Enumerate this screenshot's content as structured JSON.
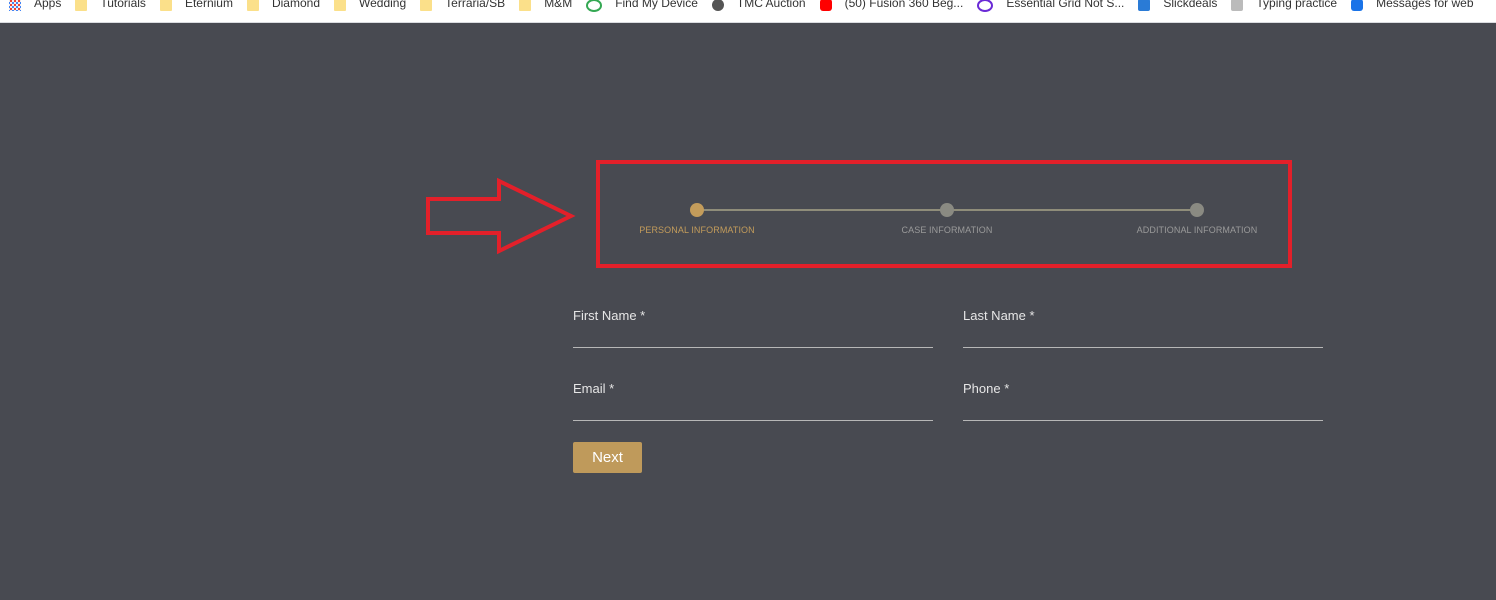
{
  "bookmarks": [
    {
      "label": "Apps",
      "icon": "apps-grid-icon"
    },
    {
      "label": "Tutorials",
      "icon": "folder-icon"
    },
    {
      "label": "Eternium",
      "icon": "folder-icon"
    },
    {
      "label": "Diamond",
      "icon": "folder-icon"
    },
    {
      "label": "Wedding",
      "icon": "folder-icon"
    },
    {
      "label": "Terraria/SB",
      "icon": "folder-icon"
    },
    {
      "label": "M&M",
      "icon": "folder-icon"
    },
    {
      "label": "Find My Device",
      "icon": "find-my-device-icon"
    },
    {
      "label": "TMC Auction",
      "icon": "globe-icon"
    },
    {
      "label": "(50) Fusion 360 Beg...",
      "icon": "youtube-icon"
    },
    {
      "label": "Essential Grid Not S...",
      "icon": "themepunch-icon"
    },
    {
      "label": "Slickdeals",
      "icon": "slickdeals-icon"
    },
    {
      "label": "Typing practice",
      "icon": "typing-icon"
    },
    {
      "label": "Messages for web",
      "icon": "messages-icon"
    }
  ],
  "stepper": {
    "steps": [
      {
        "label": "PERSONAL INFORMATION",
        "active": true
      },
      {
        "label": "CASE INFORMATION",
        "active": false
      },
      {
        "label": "ADDITIONAL INFORMATION",
        "active": false
      }
    ]
  },
  "form": {
    "first_name_label": "First Name *",
    "last_name_label": "Last Name *",
    "email_label": "Email *",
    "phone_label": "Phone *",
    "first_name_value": "",
    "last_name_value": "",
    "email_value": "",
    "phone_value": "",
    "next_label": "Next"
  },
  "colors": {
    "background": "#484a51",
    "accent": "#bf9a5b",
    "annotation_red": "#e3202a",
    "inactive_step": "#8a8a82"
  }
}
